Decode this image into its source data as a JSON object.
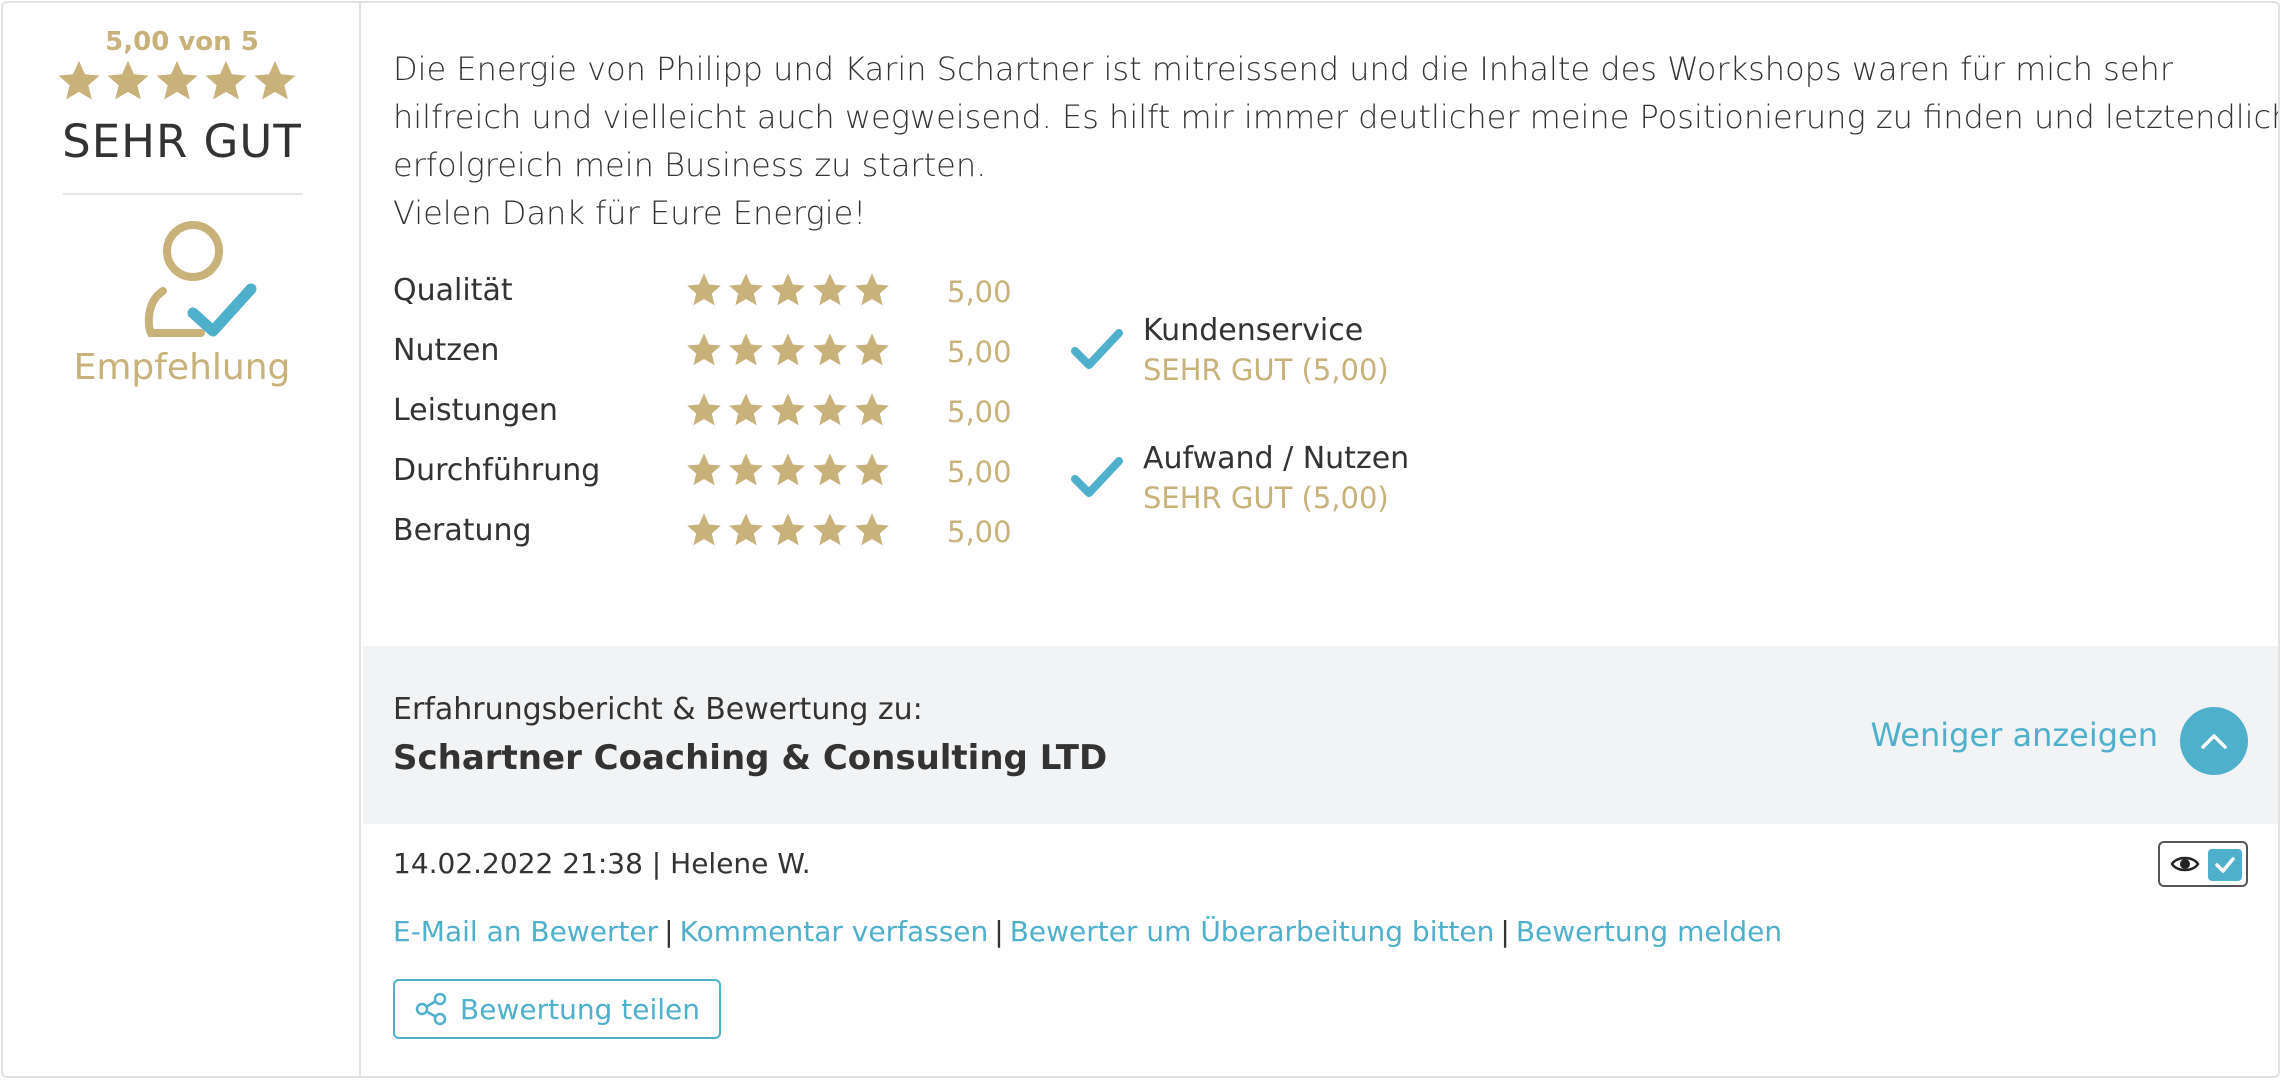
{
  "summary": {
    "score_text": "5,00 von 5",
    "stars": 5,
    "grade": "SEHR GUT",
    "recommendation_label": "Empfehlung"
  },
  "review": {
    "paragraphs": [
      "Die Energie von Philipp und Karin Schartner ist mitreissend und die Inhalte des Workshops waren für mich sehr hilfreich und vielleicht auch wegweisend. Es hilft mir immer deutlicher meine Positionierung zu finden und letztendlich erfolgreich mein Business zu starten.",
      "Vielen Dank für Eure Energie!"
    ]
  },
  "ratings": [
    {
      "label": "Qualität",
      "value": "5,00",
      "stars": 5
    },
    {
      "label": "Nutzen",
      "value": "5,00",
      "stars": 5
    },
    {
      "label": "Leistungen",
      "value": "5,00",
      "stars": 5
    },
    {
      "label": "Durchführung",
      "value": "5,00",
      "stars": 5
    },
    {
      "label": "Beratung",
      "value": "5,00",
      "stars": 5
    }
  ],
  "checks": [
    {
      "title": "Kundenservice",
      "value": "SEHR GUT (5,00)"
    },
    {
      "title": "Aufwand / Nutzen",
      "value": "SEHR GUT (5,00)"
    }
  ],
  "company": {
    "intro": "Erfahrungsbericht & Bewertung zu:",
    "name": "Schartner Coaching & Consulting LTD",
    "less_label": "Weniger anzeigen"
  },
  "meta": {
    "text": "14.02.2022 21:38 | Helene W."
  },
  "actions": {
    "email": "E-Mail an Bewerter",
    "comment": "Kommentar verfassen",
    "revise": "Bewerter um Überarbeitung bitten",
    "report": "Bewertung melden",
    "share": "Bewertung teilen"
  },
  "colors": {
    "gold": "#c8b27a",
    "accent": "#4fb0cc",
    "bar_bg": "#f2f3f4"
  },
  "icons": [
    "star-icon",
    "user-check-icon",
    "checkmark-icon",
    "chevron-up-icon",
    "eye-icon",
    "checkbox-icon",
    "share-icon"
  ]
}
